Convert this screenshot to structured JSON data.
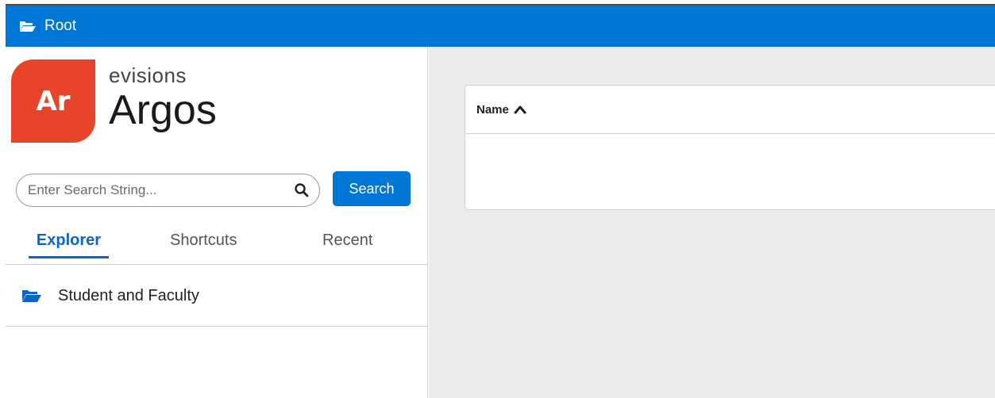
{
  "topbar": {
    "title": "Root",
    "icon": "folder-open-icon"
  },
  "logo": {
    "mark": "Ar",
    "brand": "evisions",
    "product": "Argos",
    "mark_color": "#e8442a"
  },
  "search": {
    "placeholder": "Enter Search String...",
    "value": "",
    "button_label": "Search"
  },
  "tabs": [
    {
      "label": "Explorer",
      "active": true
    },
    {
      "label": "Shortcuts",
      "active": false
    },
    {
      "label": "Recent",
      "active": false
    }
  ],
  "tree": {
    "items": [
      {
        "label": "Student and Faculty",
        "icon": "folder-open-icon"
      }
    ]
  },
  "table": {
    "columns": [
      {
        "label": "Name",
        "sort": "ascending",
        "sort_icon": "chevron-up-icon"
      }
    ],
    "rows": []
  },
  "colors": {
    "accent": "#0076d6",
    "brand": "#e8442a",
    "main_bg": "#ececec"
  }
}
